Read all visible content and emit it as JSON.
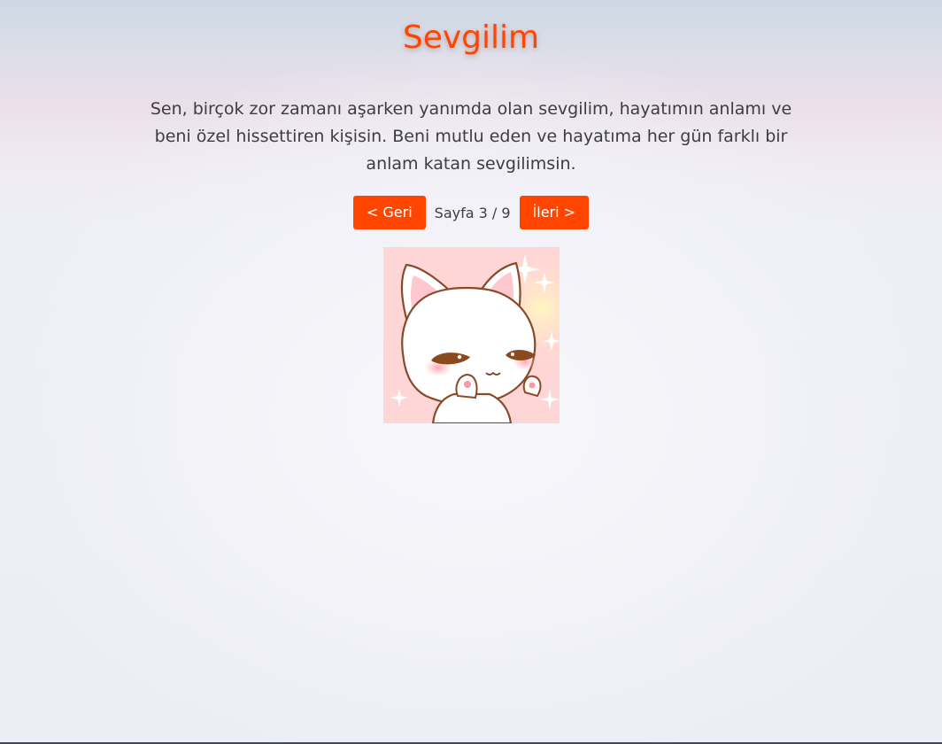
{
  "header": {
    "title": "Sevgilim"
  },
  "main": {
    "message": "Sen, birçok zor zamanı aşarken yanımda olan sevgilim, hayatımın anlamı ve beni özel hissettiren kişisin. Beni mutlu eden ve hayatıma her gün farklı bir anlam katan sevgilimsin."
  },
  "pager": {
    "prev_label": "< Geri",
    "page_info": "Sayfa 3 / 9",
    "next_label": "İleri >",
    "current_page": 3,
    "total_pages": 9
  },
  "image": {
    "subject": "white-cat-sticker"
  },
  "colors": {
    "accent": "#ff4500",
    "text": "#3c3c46",
    "sticker_background": "#ffd6d6"
  }
}
